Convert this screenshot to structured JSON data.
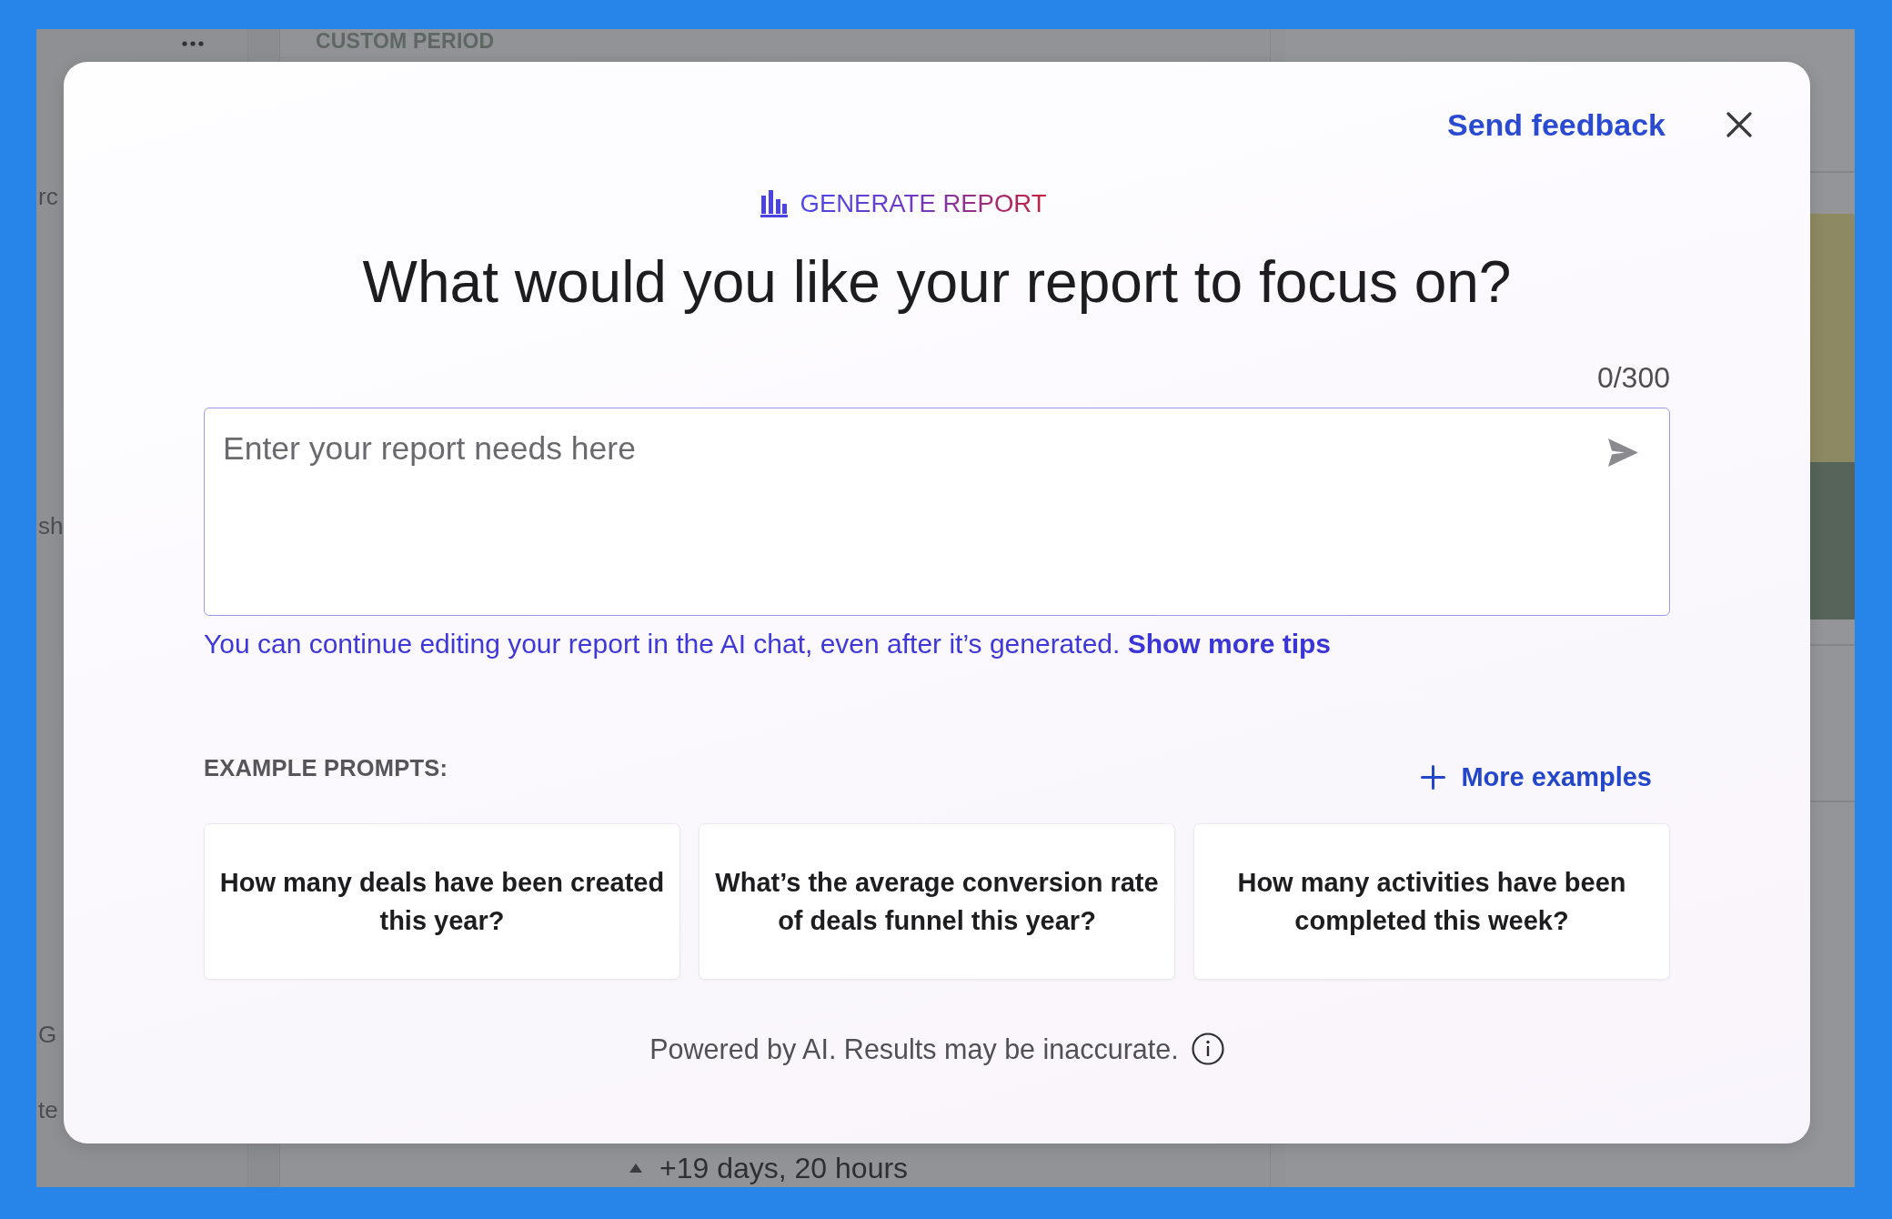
{
  "background": {
    "sidebar_fragments": [
      "rc",
      "sh",
      "G",
      "te"
    ],
    "header": "CUSTOM PERIOD",
    "footer_reading": "+19 days, 20 hours"
  },
  "dialog": {
    "send_feedback": "Send feedback",
    "eyebrow": "GENERATE REPORT",
    "title": "What would you like your report to focus on?",
    "counter": "0/300",
    "input": {
      "placeholder": "Enter your report needs here"
    },
    "tip": {
      "text": "You can continue editing your report in the AI chat, even after it’s generated.",
      "link": "Show more tips"
    },
    "examples_label": "EXAMPLE PROMPTS:",
    "more_examples": "More examples",
    "example_prompts": [
      "How many deals have been created this year?",
      "What’s the average conversion rate of deals funnel this year?",
      "How many activities have been completed this week?"
    ],
    "disclaimer": "Powered by AI. Results may be inaccurate."
  }
}
